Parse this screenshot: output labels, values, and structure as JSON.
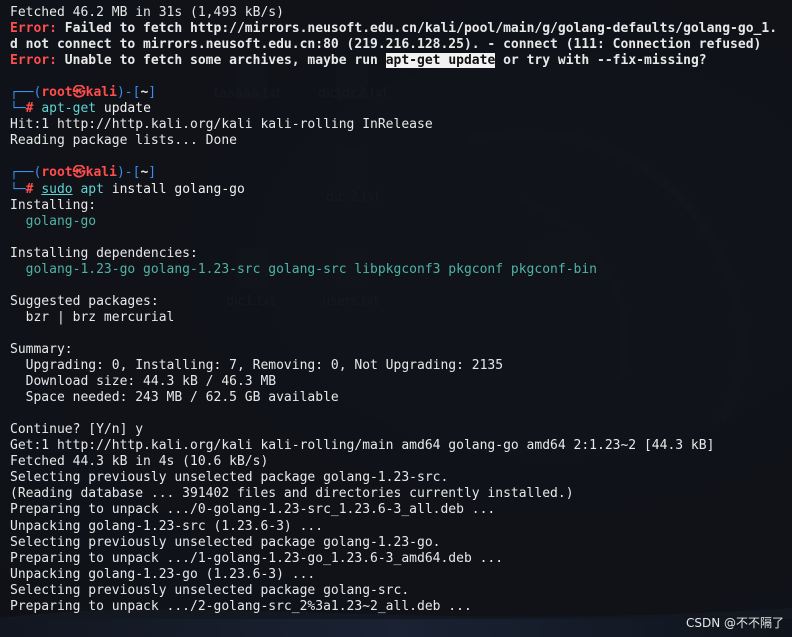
{
  "desktop": {
    "icons": [
      {
        "label": "taaaaa.txt"
      },
      {
        "label": "dictdc2.txt"
      },
      {
        "label": "dic-2.txt"
      },
      {
        "label": "dic1.txt"
      },
      {
        "label": "users.txt"
      }
    ]
  },
  "terminal": {
    "prompt_user": "root",
    "prompt_at": "㉿",
    "prompt_host": "kali",
    "prompt_dir": "~",
    "fetch_line": "Fetched 46.2 MB in 31s (1,493 kB/s)",
    "error_label": "Error:",
    "error1_text": " Failed to fetch http://mirrors.neusoft.edu.cn/kali/pool/main/g/golang-defaults/golang-go_1.",
    "error1_cont": "d not connect to mirrors.neusoft.edu.cn:80 (219.216.128.25). - connect (111: Connection refused)",
    "error2_pre": " Unable to fetch some archives, maybe run ",
    "error2_hl": "apt-get update",
    "error2_post": " or try with --fix-missing?",
    "cmd1_a": "apt-get",
    "cmd1_b": " update",
    "hit1": "Hit:1 http://http.kali.org/kali kali-rolling InRelease",
    "reading": "Reading package lists... Done",
    "cmd2_sudo": "sudo",
    "cmd2_apt": "apt",
    "cmd2_rest": " install golang-go",
    "installing": "Installing:",
    "installing_pkg": "  golang-go",
    "deps_head": "Installing dependencies:",
    "deps": "  golang-1.23-go golang-1.23-src golang-src libpkgconf3 pkgconf pkgconf-bin",
    "suggested_head": "Suggested packages:",
    "suggested": "  bzr | brz mercurial",
    "summary_head": "Summary:",
    "summary1": "  Upgrading: 0, Installing: 7, Removing: 0, Not Upgrading: 2135",
    "summary2": "  Download size: 44.3 kB / 46.3 MB",
    "summary3": "  Space needed: 243 MB / 62.5 GB available",
    "continue": "Continue? [Y/n] y",
    "get1": "Get:1 http://http.kali.org/kali kali-rolling/main amd64 golang-go amd64 2:1.23~2 [44.3 kB]",
    "fetched2": "Fetched 44.3 kB in 4s (10.6 kB/s)",
    "sel1": "Selecting previously unselected package golang-1.23-src.",
    "readingdb": "(Reading database ... 391402 files and directories currently installed.)",
    "prep1": "Preparing to unpack .../0-golang-1.23-src_1.23.6-3_all.deb ...",
    "unpack1": "Unpacking golang-1.23-src (1.23.6-3) ...",
    "sel2": "Selecting previously unselected package golang-1.23-go.",
    "prep2": "Preparing to unpack .../1-golang-1.23-go_1.23.6-3_amd64.deb ...",
    "unpack2": "Unpacking golang-1.23-go (1.23.6-3) ...",
    "sel3": "Selecting previously unselected package golang-src.",
    "prep3": "Preparing to unpack .../2-golang-src_2%3a1.23~2_all.deb ..."
  },
  "watermark": "CSDN @不不隔了"
}
